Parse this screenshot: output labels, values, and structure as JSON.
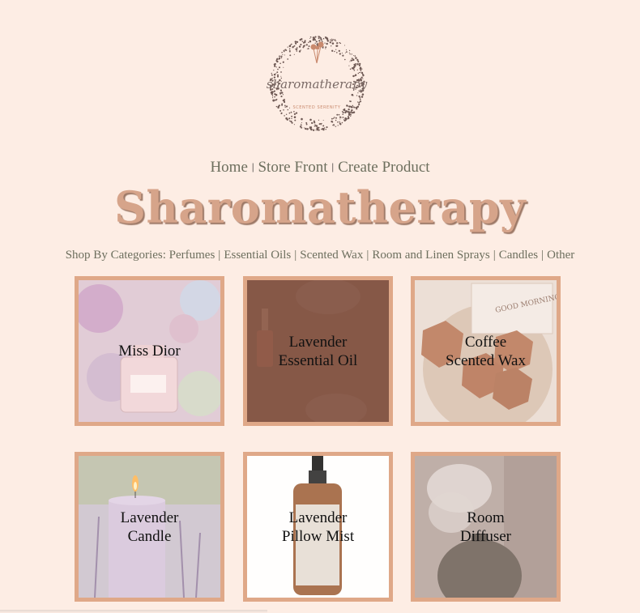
{
  "logo": {
    "script_text": "sharomatherapy",
    "tagline": "SCENTED SERENITY",
    "icon": "flower-logo-icon"
  },
  "nav": {
    "items": [
      {
        "label": "Home"
      },
      {
        "label": "Store Front"
      },
      {
        "label": "Create Product"
      }
    ],
    "separator": "|"
  },
  "brand": {
    "title": "Sharomatherapy"
  },
  "categories": {
    "prefix": "Shop By Categories:",
    "items": [
      {
        "label": "Perfumes"
      },
      {
        "label": "Essential Oils"
      },
      {
        "label": "Scented Wax"
      },
      {
        "label": "Room and Linen Sprays"
      },
      {
        "label": "Candles"
      },
      {
        "label": "Other"
      }
    ],
    "separator": "|"
  },
  "products": [
    {
      "name": "Miss Dior",
      "image": "perfume-bottle-flowers"
    },
    {
      "name": "Lavender Essential Oil",
      "image": "essential-oil-dropper"
    },
    {
      "name": "Coffee Scented Wax",
      "image": "honeycomb-wax-melts"
    },
    {
      "name": "Lavender Candle",
      "image": "lit-purple-candle"
    },
    {
      "name": "Lavender Pillow Mist",
      "image": "amber-spray-bottle"
    },
    {
      "name": "Room Diffuser",
      "image": "ceramic-mist-diffuser"
    }
  ],
  "colors": {
    "background": "#fdede4",
    "accent": "#d6a48a",
    "tile_border": "#dfa888",
    "nav_text": "#6d6f5e"
  }
}
